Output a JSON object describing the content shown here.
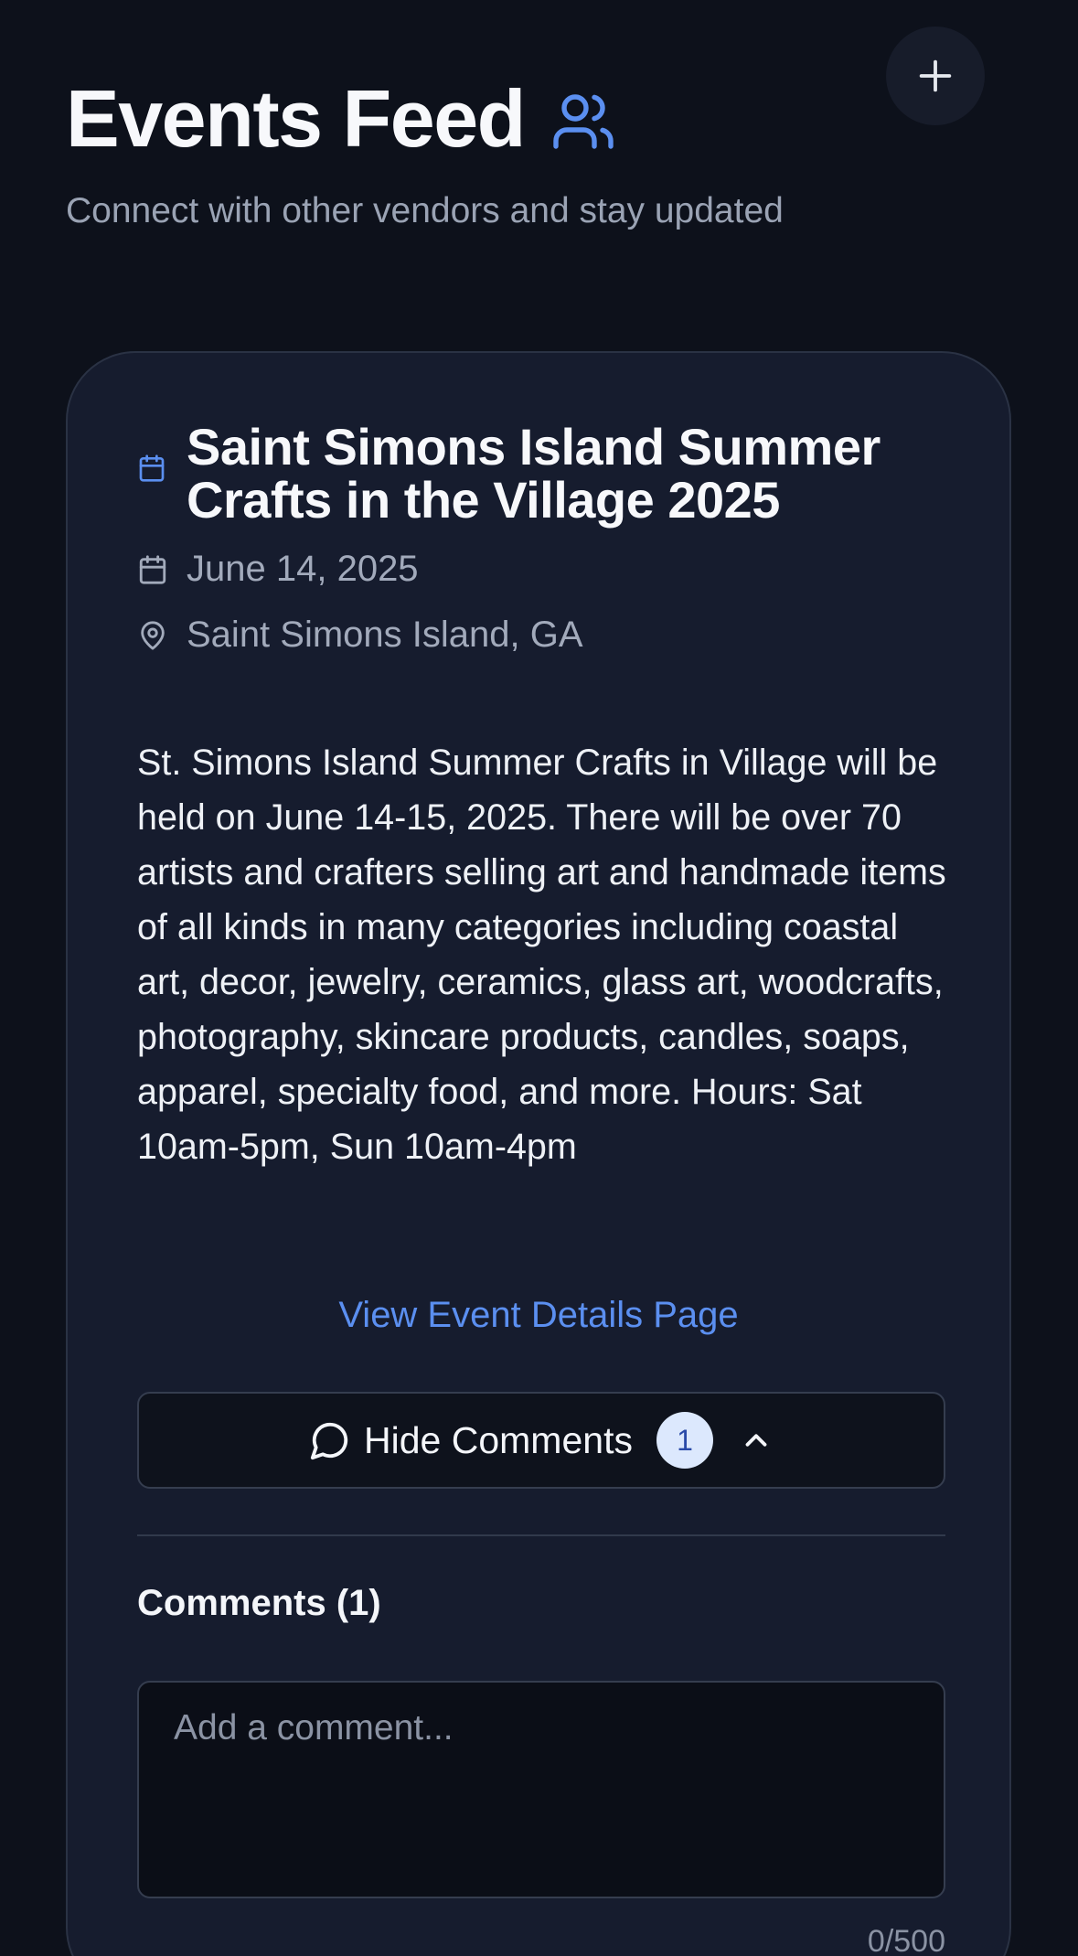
{
  "header": {
    "title": "Events Feed",
    "subtitle": "Connect with other vendors and stay updated",
    "title_icon": "users-icon",
    "add_button_icon": "plus-icon"
  },
  "event": {
    "title": "Saint Simons Island Summer Crafts in the Village 2025",
    "title_icon": "calendar-icon",
    "date": "June 14, 2025",
    "date_icon": "calendar-icon",
    "location": "Saint Simons Island, GA",
    "location_icon": "map-pin-icon",
    "description": "St. Simons Island Summer Crafts in Village will be held on June 14-15, 2025. There will be over 70 artists and crafters selling art and handmade items of all kinds in many categories including coastal art, decor, jewelry, ceramics, glass art, woodcrafts, photography, skincare products, candles, soaps, apparel, specialty food, and more. Hours: Sat 10am-5pm, Sun 10am-4pm",
    "details_link": "View Event Details Page"
  },
  "comments": {
    "toggle_label": "Hide Comments",
    "toggle_icon": "message-circle-icon",
    "chevron_icon": "chevron-up-icon",
    "count": "1",
    "heading": "Comments (1)",
    "input_placeholder": "Add a comment...",
    "input_value": "",
    "char_counter": "0/500"
  },
  "colors": {
    "background": "#0d111b",
    "card": "#161c2e",
    "accent": "#5b8ff0",
    "badge_bg": "#dce8fd",
    "muted_text": "#9aa3b4"
  }
}
